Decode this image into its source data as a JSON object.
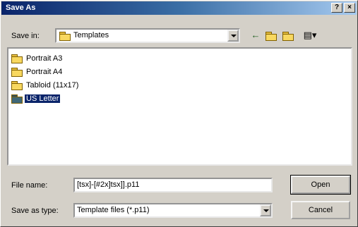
{
  "window": {
    "title": "Save As",
    "help_label": "?",
    "close_label": "×"
  },
  "toolbar": {
    "save_in_label": "Save in:",
    "save_in_value": "Templates",
    "icons": [
      "back-arrow-icon",
      "up-folder-icon",
      "new-folder-icon",
      "view-menu-icon"
    ]
  },
  "files": [
    {
      "name": "Portrait A3",
      "selected": false
    },
    {
      "name": "Portrait A4",
      "selected": false
    },
    {
      "name": "Tabloid (11x17)",
      "selected": false
    },
    {
      "name": "US Letter",
      "selected": true
    }
  ],
  "form": {
    "file_name_label": "File name:",
    "file_name_value": "[tsx]-[#2x]tsx]].p11",
    "save_as_type_label": "Save as type:",
    "save_as_type_value": "Template files (*.p11)"
  },
  "buttons": {
    "open": "Open",
    "cancel": "Cancel"
  },
  "colors": {
    "titlebar": "#0a246a",
    "selection": "#0a246a",
    "face": "#d4d0c8"
  }
}
